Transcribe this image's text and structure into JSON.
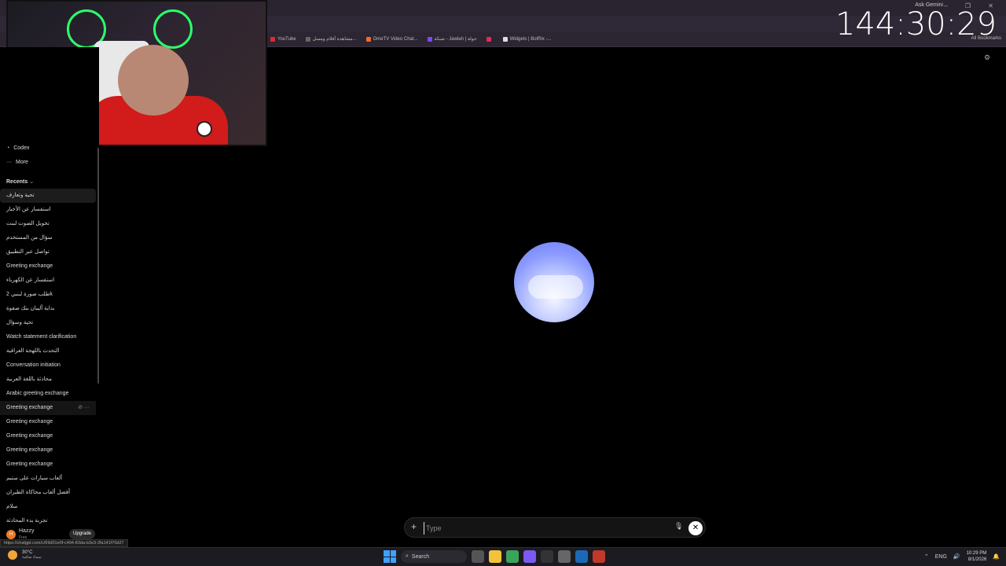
{
  "browser": {
    "ask_gemini": "Ask Gemini",
    "window_controls": "–  ❐  ✕",
    "bookmarks": [
      {
        "label": "YouTube",
        "color": "#e02b2b"
      },
      {
        "label": "مشاهدة أفلام ومسل...",
        "color": "#666"
      },
      {
        "label": "OmeTV Video Chat...",
        "color": "#f06a2b"
      },
      {
        "label": "شبكة - Jawlah | جولة",
        "color": "#7a4cf0"
      },
      {
        "label": "",
        "color": "#e02b5a"
      },
      {
        "label": "Widgets | BotRix -...",
        "color": "#ddd"
      }
    ],
    "all_bookmarks": "All Bookmarks"
  },
  "overlay": {
    "timer": "144:30:29"
  },
  "sidebar": {
    "top_items": [
      {
        "label": "Codex",
        "icon": "codex-icon"
      },
      {
        "label": "More",
        "icon": "more-icon"
      }
    ],
    "recents_label": "Recents",
    "recents": [
      "تحية وتعارف",
      "استفسار عن الأخبار",
      "تحويل الصوت لبنت",
      "سؤال من المستخدم",
      "تواصل عبر التطبيق",
      "Greeting exchange",
      "استفسار عن الكهرباء",
      "طلب صورة لبنبي 2k",
      "بداية أليبان بنك صفوة",
      "تحية وسؤال",
      "Watch statement clarification",
      "التحدث باللهجة العراقية",
      "Conversation initiation",
      "محادثة باللغة العربية",
      "Arabic greeting exchange",
      "Greeting exchange",
      "Greeting exchange",
      "Greeting exchange",
      "Greeting exchange",
      "Greeting exchange",
      "ألعاب سيارات على ستيم",
      "أفضل ألعاب محاكاة الطيران",
      "سلام",
      "تجربة بدء المحادثة"
    ],
    "user": {
      "name": "Hazzy",
      "plan": "Free",
      "initial": "H",
      "upgrade_label": "Upgrade"
    },
    "status_url": "https://chatgpt.com/c/69d01e0f-c494-83da-b3e3-2fa141f70d27"
  },
  "composer": {
    "placeholder": "Type",
    "plus": "+",
    "mic": "🎙",
    "end": "✕"
  },
  "taskbar": {
    "weather_temp": "30°C",
    "weather_desc": "سماء صافية",
    "search_label": "Search",
    "tray_lang": "ENG",
    "time": "10:29 PM",
    "date": "8/1/2026"
  },
  "colors": {
    "orb_primary": "#8a9aff",
    "accent_avatar": "#e87a2a"
  }
}
